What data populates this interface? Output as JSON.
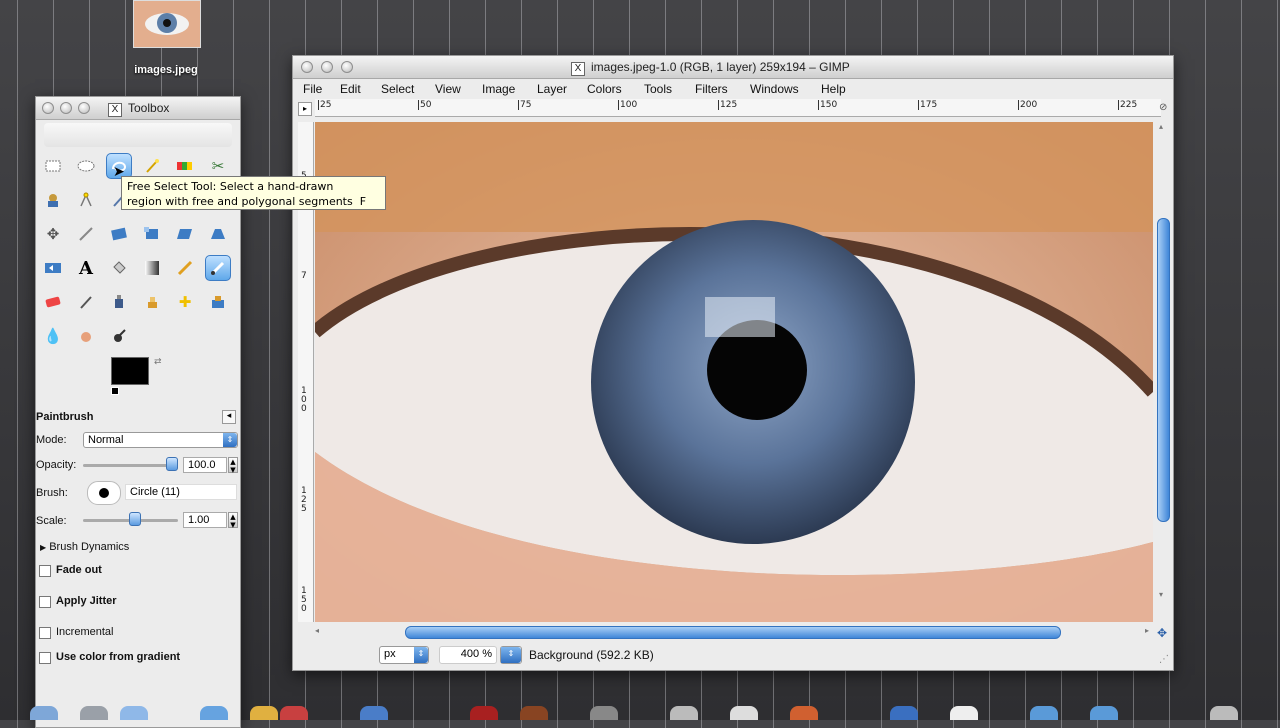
{
  "desktop": {
    "icon_label": "images.jpeg"
  },
  "toolbox": {
    "title": "Toolbox",
    "tool_options_title": "Paintbrush",
    "mode_label": "Mode:",
    "mode_value": "Normal",
    "opacity_label": "Opacity:",
    "opacity_value": "100.0",
    "brush_label": "Brush:",
    "brush_value": "Circle (11)",
    "scale_label": "Scale:",
    "scale_value": "1.00",
    "brush_dynamics_label": "Brush Dynamics",
    "fade_out_label": "Fade out",
    "apply_jitter_label": "Apply Jitter",
    "incremental_label": "Incremental",
    "use_gradient_label": "Use color from gradient",
    "opacity_level": 1.0,
    "scale_level": 0.55
  },
  "tooltip": {
    "line1": "Free Select Tool:  Select a hand-drawn",
    "line2": "region with free and polygonal segments",
    "shortcut": "F"
  },
  "image_window": {
    "title": "images.jpeg-1.0 (RGB, 1 layer) 259x194 – GIMP",
    "menus": [
      "File",
      "Edit",
      "Select",
      "View",
      "Image",
      "Layer",
      "Colors",
      "Tools",
      "Filters",
      "Windows",
      "Help"
    ],
    "hruler_ticks": [
      "25",
      "50",
      "75",
      "100",
      "125",
      "150",
      "175",
      "200",
      "225"
    ],
    "vruler_ticks": [
      "5",
      "7",
      "1 0 0",
      "1 2 5",
      "1 5 0"
    ],
    "units": "px",
    "zoom": "400 %",
    "status": "Background (592.2 KB)"
  },
  "colors": {
    "accent": "#3d7cc4",
    "fg_color": "#000000"
  }
}
